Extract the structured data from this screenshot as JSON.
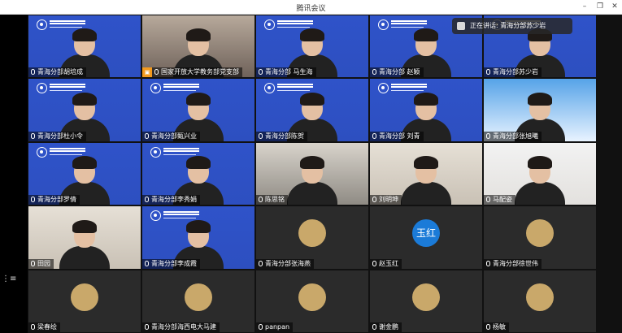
{
  "window": {
    "title": "腾讯会议"
  },
  "speaking": {
    "label": "正在讲话: 青海分部苏少岩"
  },
  "tiles": [
    {
      "name": "青海分部胡培成",
      "bg": "blue"
    },
    {
      "name": "国家开放大学教务部党支部",
      "bg": "hall",
      "host": true
    },
    {
      "name": "青海分部 马生海",
      "bg": "blue"
    },
    {
      "name": "青海分部 赵颖",
      "bg": "blue"
    },
    {
      "name": "青海分部苏少岩",
      "bg": "blue"
    },
    {
      "name": "青海分部杜小令",
      "bg": "blue"
    },
    {
      "name": "青海分部甄兴业",
      "bg": "blue"
    },
    {
      "name": "青海分部陈贺",
      "bg": "blue"
    },
    {
      "name": "青海分部 刘青",
      "bg": "blue"
    },
    {
      "name": "青海分部张旭曦",
      "bg": "screen"
    },
    {
      "name": "青海分部罗倩",
      "bg": "blue"
    },
    {
      "name": "青海分部李秀娟",
      "bg": "blue"
    },
    {
      "name": "陈思铭",
      "bg": "room"
    },
    {
      "name": "刘明坤",
      "bg": "shelf"
    },
    {
      "name": "马配姿",
      "bg": "white"
    },
    {
      "name": "田园",
      "bg": "shelf"
    },
    {
      "name": "青海分部李成霞",
      "bg": "blue"
    },
    {
      "name": "青海分部张海燕",
      "bg": "dark",
      "avatar": "photo"
    },
    {
      "name": "赵玉红",
      "bg": "dark",
      "avatar": "text",
      "avatar_text": "玉红"
    },
    {
      "name": "青海分部徐世伟",
      "bg": "dark",
      "avatar": "photo"
    },
    {
      "name": "梁春绘",
      "bg": "dark",
      "avatar": "photo"
    },
    {
      "name": "青海分部海西电大马建",
      "bg": "dark",
      "avatar": "photo"
    },
    {
      "name": "panpan",
      "bg": "dark",
      "avatar": "photo"
    },
    {
      "name": "谢金鹏",
      "bg": "dark",
      "avatar": "photo"
    },
    {
      "name": "杨敏",
      "bg": "dark",
      "avatar": "photo"
    }
  ]
}
